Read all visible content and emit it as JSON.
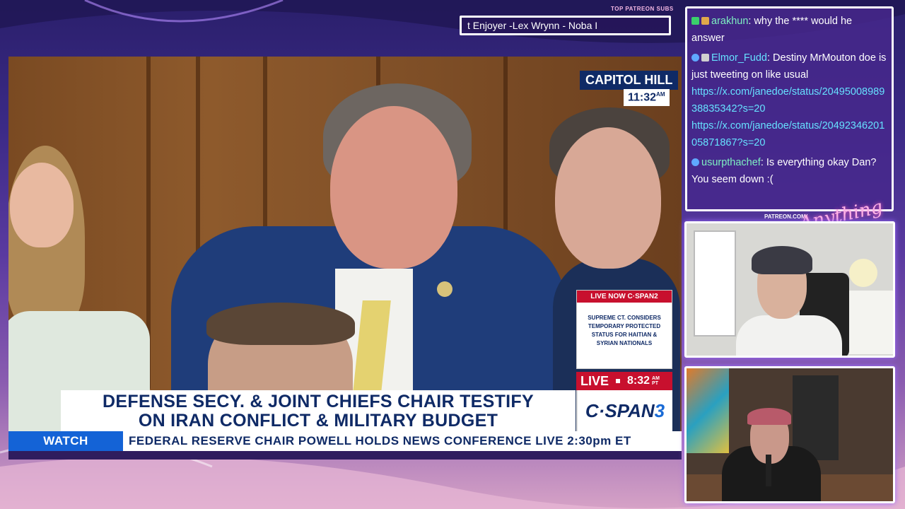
{
  "overlay": {
    "patreon_label": "TOP PATREON SUBS",
    "patreon_ticker": "t Enjoyer -Lex Wrynn -  Noba I",
    "patreon_url": "PATREON.COM/",
    "brand_script": "Anything else?"
  },
  "broadcast": {
    "location": "CAPITOL HILL",
    "local_time": "11:32",
    "local_time_suffix": "AM",
    "live_now_header": "LIVE NOW C·SPAN2",
    "live_now_text": "SUPREME CT. CONSIDERS TEMPORARY PROTECTED STATUS FOR HAITIAN & SYRIAN NATIONALS",
    "live_word": "LIVE",
    "live_time": "8:32",
    "live_ampm_top": "AM",
    "live_ampm_bottom": "PT",
    "headline_line1": "DEFENSE SECY. & JOINT CHIEFS CHAIR TESTIFY",
    "headline_line2": "ON IRAN CONFLICT & MILITARY BUDGET",
    "network_main": "C·SPAN",
    "network_number": "3",
    "watch_label": "WATCH",
    "watch_text": "FEDERAL RESERVE CHAIR POWELL HOLDS NEWS CONFERENCE  LIVE 2:30pm ET"
  },
  "chat": {
    "messages": [
      {
        "user": "arakhun",
        "text": ": why the **** would he answer"
      },
      {
        "user": "Elmor_Fudd",
        "text": ": Destiny MrMouton doe is just tweeting on like usual",
        "links": [
          "https://x.com/janedoe/status/2049500898938835342?s=20",
          "https://x.com/janedoe/status/2049234620105871867?s=20"
        ]
      },
      {
        "user": "usurpthachef",
        "text": ": Is everything okay Dan? You seem down :("
      }
    ]
  },
  "colors": {
    "cspan_navy": "#0f2a66",
    "cspan_red": "#c8102e",
    "watch_blue": "#1463d6",
    "chat_user_green": "#7ef0c2",
    "chat_link_cyan": "#66e0ff"
  }
}
